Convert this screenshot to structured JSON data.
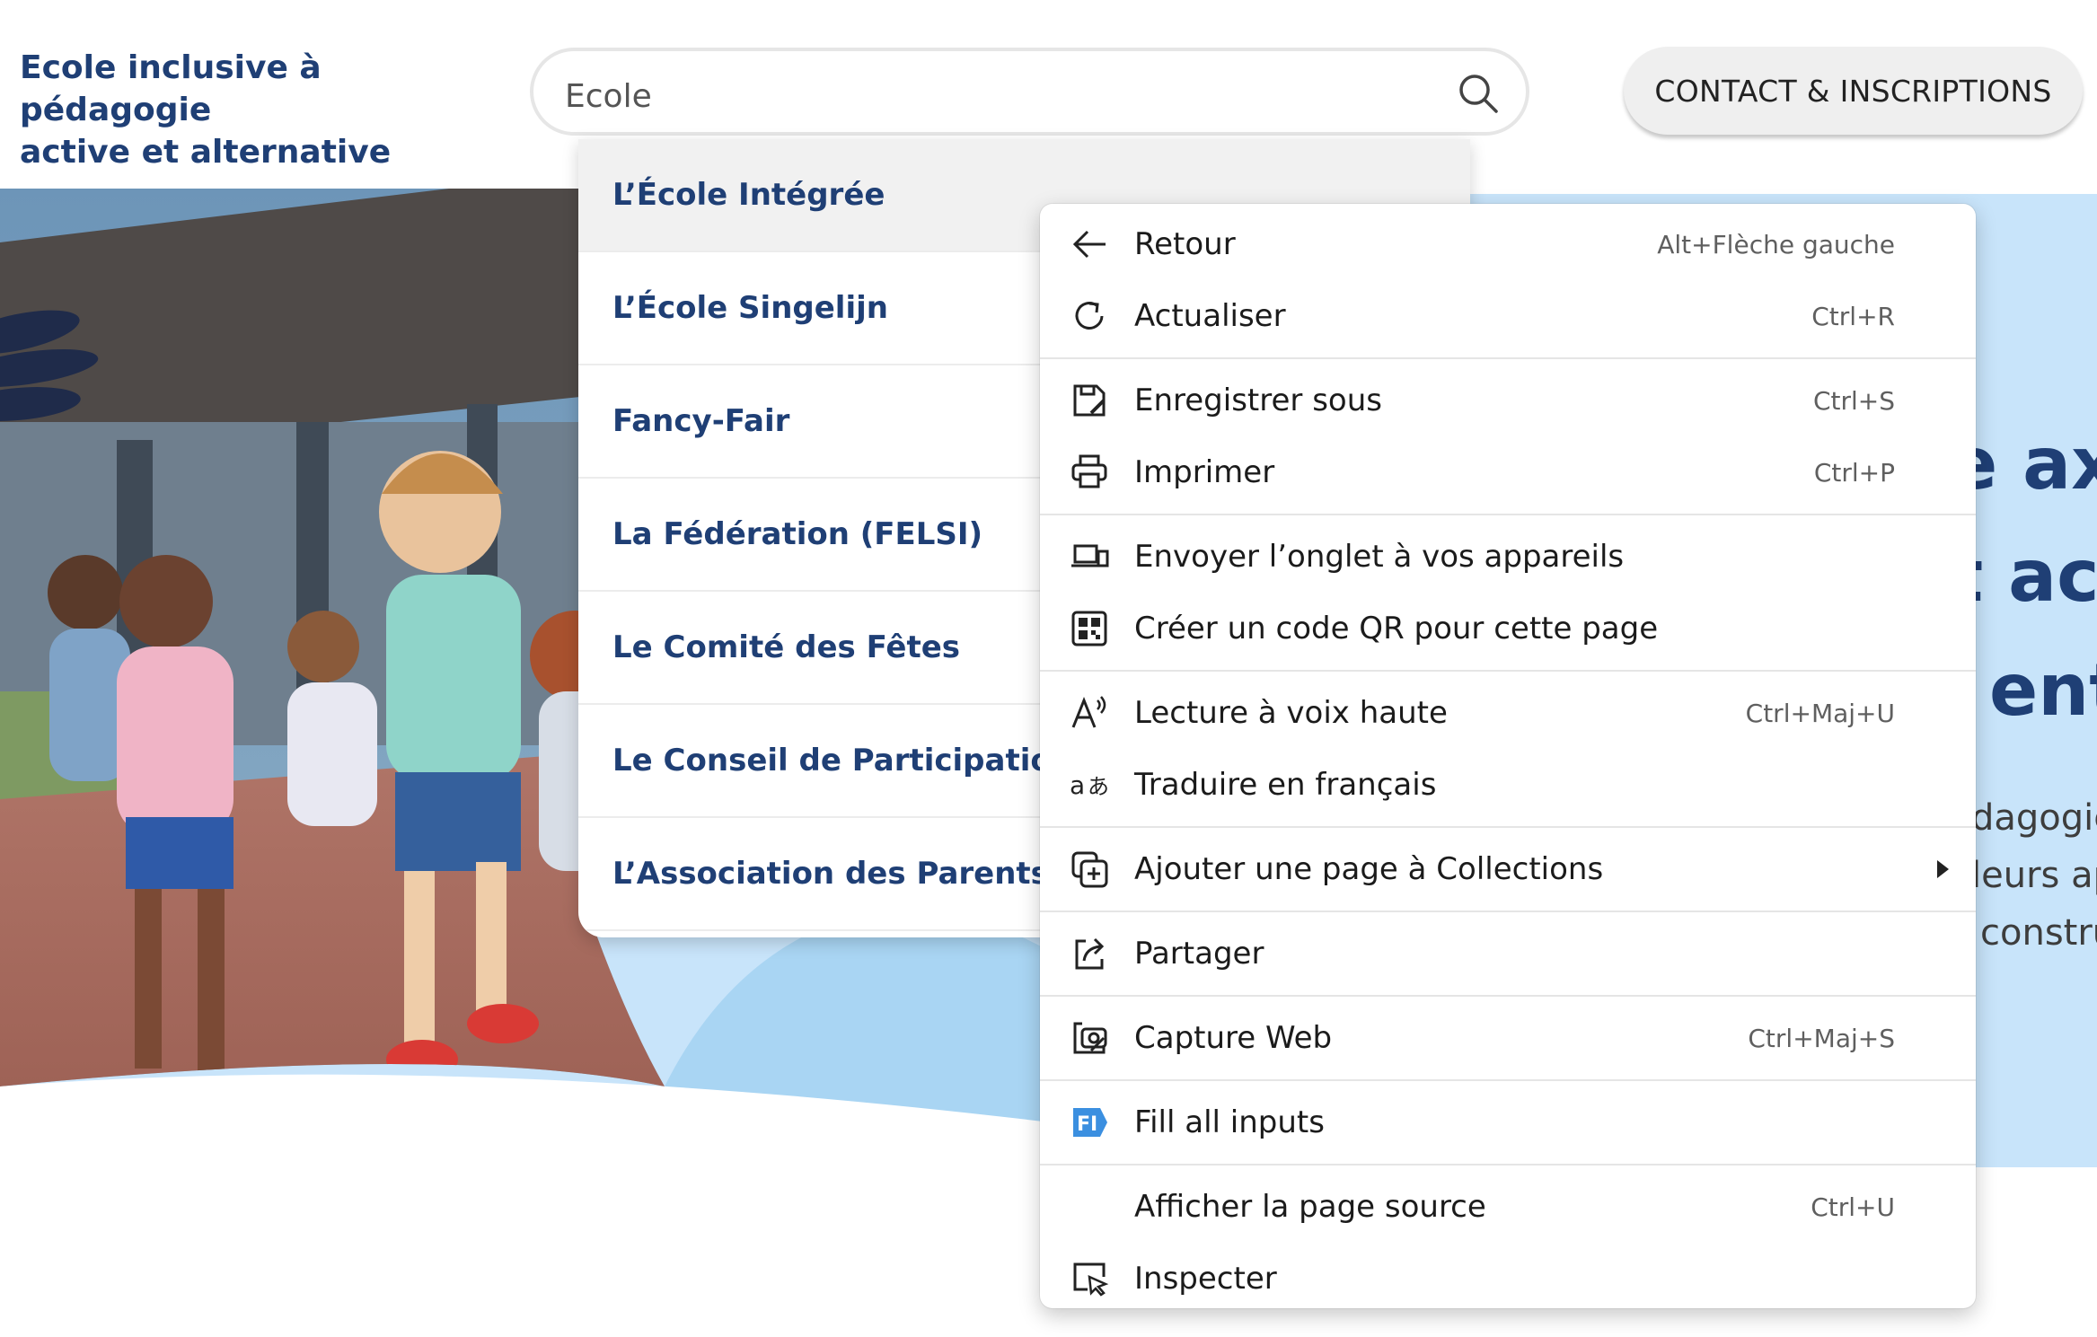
{
  "header": {
    "tagline_line1": "Ecole inclusive à pédagogie",
    "tagline_line2": "active et alternative",
    "search_value": "Ecole",
    "contact_button": "CONTACT & INSCRIPTIONS"
  },
  "suggestions": [
    "L’École Intégrée",
    "L’École Singelijn",
    "Fancy-Fair",
    "La Fédération (FELSI)",
    "Le Comité des Fêtes",
    "Le Conseil de Participation",
    "L’Association des Parents"
  ],
  "hero": {
    "heading_lines": [
      "e ax",
      "t ac",
      "ent"
    ],
    "body_lines": [
      "dagogie",
      "leurs ap",
      "constru"
    ]
  },
  "context_menu": {
    "items": [
      {
        "label": "Retour",
        "shortcut": "Alt+Flèche gauche",
        "icon": "back-arrow-icon"
      },
      {
        "label": "Actualiser",
        "shortcut": "Ctrl+R",
        "icon": "refresh-icon"
      },
      {
        "label": "Enregistrer sous",
        "shortcut": "Ctrl+S",
        "icon": "save-as-icon"
      },
      {
        "label": "Imprimer",
        "shortcut": "Ctrl+P",
        "icon": "printer-icon"
      },
      {
        "label": "Envoyer l’onglet à vos appareils",
        "shortcut": "",
        "icon": "send-to-devices-icon"
      },
      {
        "label": "Créer un code QR pour cette page",
        "shortcut": "",
        "icon": "qr-code-icon"
      },
      {
        "label": "Lecture à voix haute",
        "shortcut": "Ctrl+Maj+U",
        "icon": "read-aloud-icon"
      },
      {
        "label": "Traduire en français",
        "shortcut": "",
        "icon": "translate-icon"
      },
      {
        "label": "Ajouter une page à Collections",
        "shortcut": "",
        "icon": "collections-icon"
      },
      {
        "label": "Partager",
        "shortcut": "",
        "icon": "share-icon"
      },
      {
        "label": "Capture Web",
        "shortcut": "Ctrl+Maj+S",
        "icon": "web-capture-icon"
      },
      {
        "label": "Fill all inputs",
        "shortcut": "",
        "icon": "fill-inputs-extension-icon"
      },
      {
        "label": "Afficher la page source",
        "shortcut": "Ctrl+U",
        "icon": ""
      },
      {
        "label": "Inspecter",
        "shortcut": "",
        "icon": "inspect-icon"
      }
    ]
  },
  "colors": {
    "brand_navy": "#1f3f75",
    "hero_blue": "#c8e4fa",
    "extension_blue": "#3b8fe0"
  }
}
